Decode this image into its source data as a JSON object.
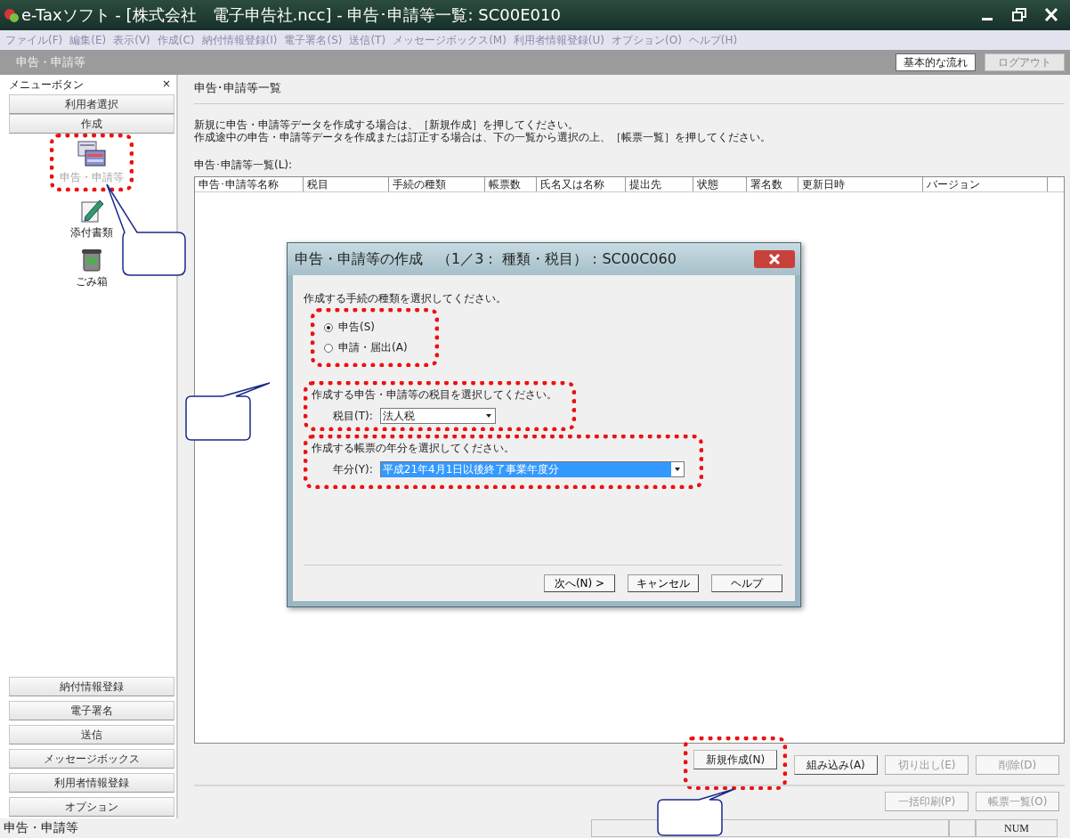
{
  "window": {
    "title": "e-Taxソフト - [株式会社　電子申告社.ncc] - 申告･申請等一覧: SC00E010"
  },
  "menu": [
    "ファイル(F)",
    "編集(E)",
    "表示(V)",
    "作成(C)",
    "納付情報登録(I)",
    "電子署名(S)",
    "送信(T)",
    "メッセージボックス(M)",
    "利用者情報登録(U)",
    "オプション(O)",
    "ヘルプ(H)"
  ],
  "header": {
    "title": "申告・申請等",
    "buttons": [
      {
        "label": "基本的な流れ",
        "disabled": false
      },
      {
        "label": "ログアウト",
        "disabled": true
      }
    ]
  },
  "sidebar": {
    "title": "メニューボタン",
    "close": "×",
    "top_buttons": [
      "利用者選択",
      "作成"
    ],
    "items": [
      {
        "label": "申告・申請等",
        "kind": "forms",
        "disabled": true
      },
      {
        "label": "添付書類",
        "kind": "attach",
        "disabled": false
      },
      {
        "label": "ごみ箱",
        "kind": "trash",
        "disabled": false
      }
    ],
    "bottom_buttons": [
      "納付情報登録",
      "電子署名",
      "送信",
      "メッセージボックス",
      "利用者情報登録",
      "オプション"
    ]
  },
  "main": {
    "title": "申告･申請等一覧",
    "instructions": [
      "新規に申告・申請等データを作成する場合は、［新規作成］を押してください。",
      "作成途中の申告・申請等データを作成または訂正する場合は、下の一覧から選択の上、［帳票一覧］を押してください。"
    ],
    "list_label": "申告･申請等一覧(L):",
    "table": {
      "columns": [
        "申告･申請等名称",
        "税目",
        "手続の種類",
        "帳票数",
        "氏名又は名称",
        "提出先",
        "状態",
        "署名数",
        "更新日時",
        "バージョン"
      ]
    },
    "buttons": [
      {
        "label": "新規作成(N)",
        "disabled": false
      },
      {
        "label": "組み込み(A)",
        "disabled": false
      },
      {
        "label": "切り出し(E)",
        "disabled": true
      },
      {
        "label": "削除(D)",
        "disabled": true
      }
    ],
    "buttons_2": [
      {
        "label": "一括印刷(P)",
        "disabled": true
      },
      {
        "label": "帳票一覧(O)",
        "disabled": true
      }
    ]
  },
  "dialog": {
    "title": "申告・申請等の作成　（1／3： 種類・税目）：SC00C060",
    "type_prompt": "作成する手続の種類を選択してください。",
    "radios": [
      {
        "label": "申告(S)",
        "selected": true
      },
      {
        "label": "申請・届出(A)",
        "selected": false
      }
    ],
    "tax_prompt": "作成する申告・申請等の税目を選択してください。",
    "tax_label": "税目(T):",
    "tax_value": "法人税",
    "year_prompt": "作成する帳票の年分を選択してください。",
    "year_label": "年分(Y):",
    "year_value": "平成21年4月1日以後終了事業年度分",
    "buttons": [
      "次へ(N) >",
      "キャンセル",
      "ヘルプ"
    ]
  },
  "status_bar": {
    "text": "申告・申請等",
    "indicator": "NUM"
  }
}
